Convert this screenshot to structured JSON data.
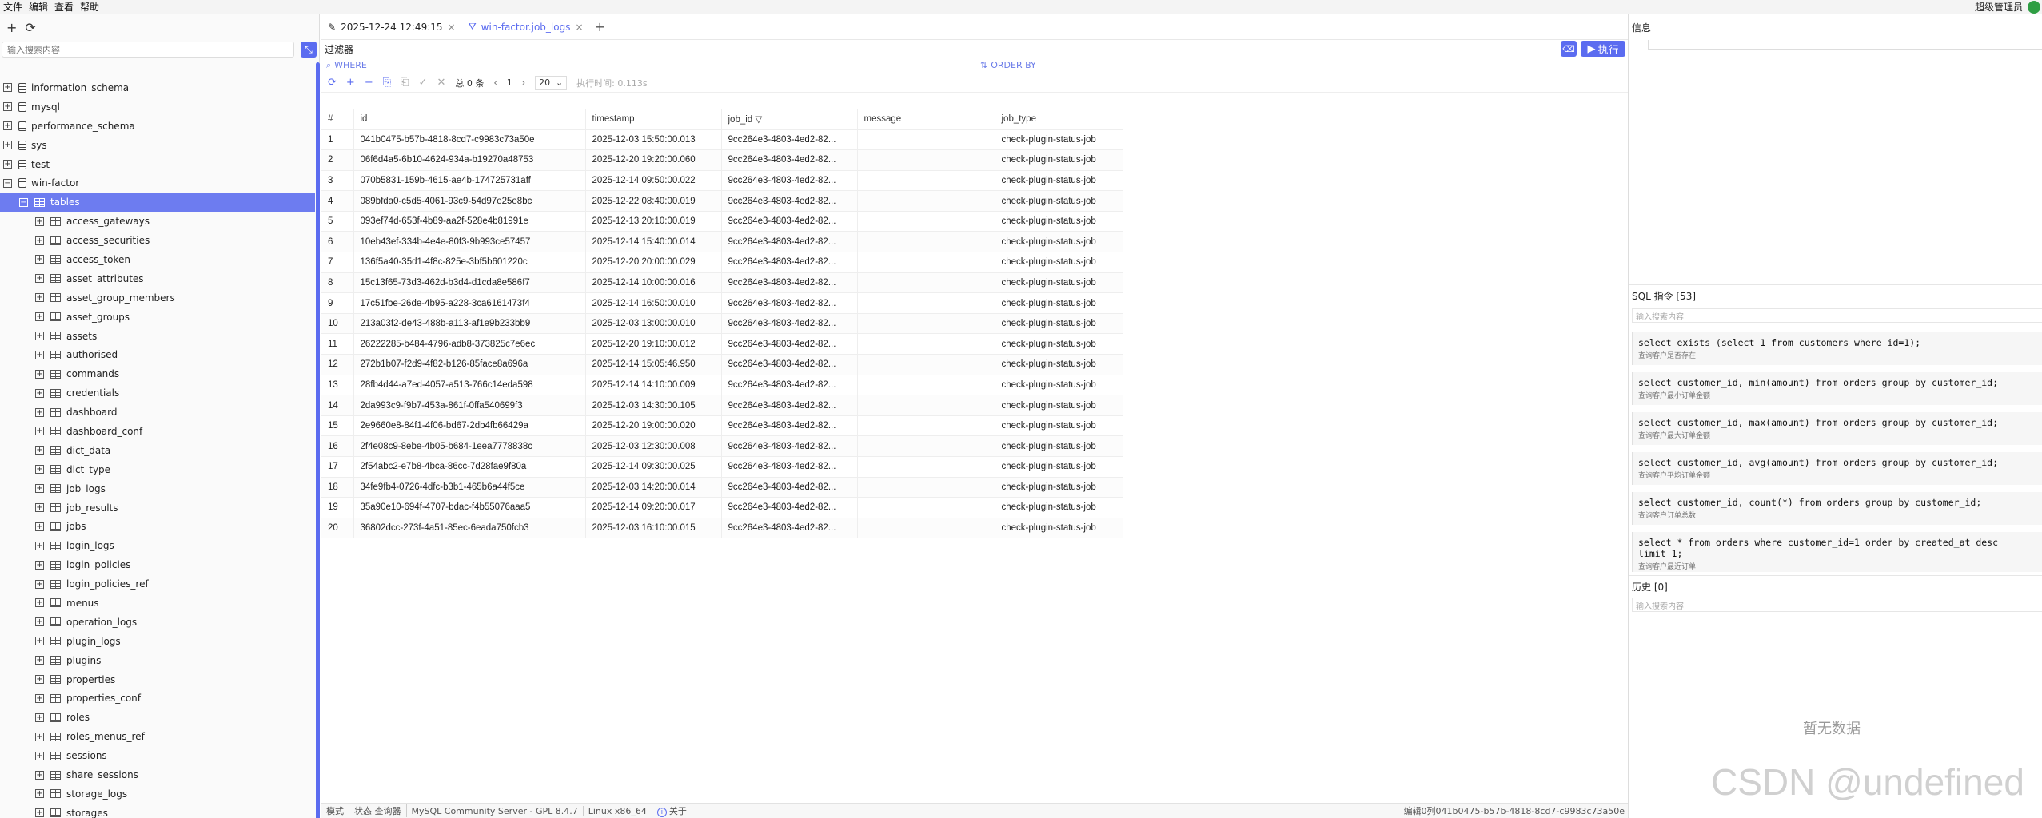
{
  "menubar": {
    "items": [
      "文件",
      "编辑",
      "查看",
      "帮助"
    ],
    "user": "超级管理员"
  },
  "left": {
    "search_placeholder": "输入搜索内容",
    "tree": [
      {
        "label": "information_schema",
        "level": 0,
        "kind": "db",
        "exp": "+"
      },
      {
        "label": "mysql",
        "level": 0,
        "kind": "db",
        "exp": "+"
      },
      {
        "label": "performance_schema",
        "level": 0,
        "kind": "db",
        "exp": "+"
      },
      {
        "label": "sys",
        "level": 0,
        "kind": "db",
        "exp": "+"
      },
      {
        "label": "test",
        "level": 0,
        "kind": "db",
        "exp": "+"
      },
      {
        "label": "win-factor",
        "level": 0,
        "kind": "db",
        "exp": "−"
      },
      {
        "label": "tables",
        "level": 1,
        "kind": "tbl",
        "exp": "−",
        "selected": true
      },
      {
        "label": "access_gateways",
        "level": 2,
        "kind": "tbl",
        "exp": "+"
      },
      {
        "label": "access_securities",
        "level": 2,
        "kind": "tbl",
        "exp": "+"
      },
      {
        "label": "access_token",
        "level": 2,
        "kind": "tbl",
        "exp": "+"
      },
      {
        "label": "asset_attributes",
        "level": 2,
        "kind": "tbl",
        "exp": "+"
      },
      {
        "label": "asset_group_members",
        "level": 2,
        "kind": "tbl",
        "exp": "+"
      },
      {
        "label": "asset_groups",
        "level": 2,
        "kind": "tbl",
        "exp": "+"
      },
      {
        "label": "assets",
        "level": 2,
        "kind": "tbl",
        "exp": "+"
      },
      {
        "label": "authorised",
        "level": 2,
        "kind": "tbl",
        "exp": "+"
      },
      {
        "label": "commands",
        "level": 2,
        "kind": "tbl",
        "exp": "+"
      },
      {
        "label": "credentials",
        "level": 2,
        "kind": "tbl",
        "exp": "+"
      },
      {
        "label": "dashboard",
        "level": 2,
        "kind": "tbl",
        "exp": "+"
      },
      {
        "label": "dashboard_conf",
        "level": 2,
        "kind": "tbl",
        "exp": "+"
      },
      {
        "label": "dict_data",
        "level": 2,
        "kind": "tbl",
        "exp": "+"
      },
      {
        "label": "dict_type",
        "level": 2,
        "kind": "tbl",
        "exp": "+"
      },
      {
        "label": "job_logs",
        "level": 2,
        "kind": "tbl",
        "exp": "+"
      },
      {
        "label": "job_results",
        "level": 2,
        "kind": "tbl",
        "exp": "+"
      },
      {
        "label": "jobs",
        "level": 2,
        "kind": "tbl",
        "exp": "+"
      },
      {
        "label": "login_logs",
        "level": 2,
        "kind": "tbl",
        "exp": "+"
      },
      {
        "label": "login_policies",
        "level": 2,
        "kind": "tbl",
        "exp": "+"
      },
      {
        "label": "login_policies_ref",
        "level": 2,
        "kind": "tbl",
        "exp": "+"
      },
      {
        "label": "menus",
        "level": 2,
        "kind": "tbl",
        "exp": "+"
      },
      {
        "label": "operation_logs",
        "level": 2,
        "kind": "tbl",
        "exp": "+"
      },
      {
        "label": "plugin_logs",
        "level": 2,
        "kind": "tbl",
        "exp": "+"
      },
      {
        "label": "plugins",
        "level": 2,
        "kind": "tbl",
        "exp": "+"
      },
      {
        "label": "properties",
        "level": 2,
        "kind": "tbl",
        "exp": "+"
      },
      {
        "label": "properties_conf",
        "level": 2,
        "kind": "tbl",
        "exp": "+"
      },
      {
        "label": "roles",
        "level": 2,
        "kind": "tbl",
        "exp": "+"
      },
      {
        "label": "roles_menus_ref",
        "level": 2,
        "kind": "tbl",
        "exp": "+"
      },
      {
        "label": "sessions",
        "level": 2,
        "kind": "tbl",
        "exp": "+"
      },
      {
        "label": "share_sessions",
        "level": 2,
        "kind": "tbl",
        "exp": "+"
      },
      {
        "label": "storage_logs",
        "level": 2,
        "kind": "tbl",
        "exp": "+"
      },
      {
        "label": "storages",
        "level": 2,
        "kind": "tbl",
        "exp": "+"
      }
    ]
  },
  "tabs": [
    {
      "label": "2025-12-24 12:49:15",
      "icon": "edit-icon",
      "active": false
    },
    {
      "label": "win-factor.job_logs",
      "icon": "filter-icon",
      "active": true
    }
  ],
  "filter": {
    "label": "过滤器",
    "run_label": "执行",
    "where": "WHERE",
    "orderby": "ORDER BY"
  },
  "grid_toolbar": {
    "total": "总 0 条",
    "page": "1",
    "page_size": "20",
    "exec_time": "执行时间: 0.113s"
  },
  "grid": {
    "columns": [
      "#",
      "id",
      "timestamp",
      "job_id",
      "message",
      "job_type"
    ],
    "rows": [
      [
        "1",
        "041b0475-b57b-4818-8cd7-c9983c73a50e",
        "2025-12-03 15:50:00.013",
        "9cc264e3-4803-4ed2-82...",
        "",
        "check-plugin-status-job"
      ],
      [
        "2",
        "06f6d4a5-6b10-4624-934a-b19270a48753",
        "2025-12-20 19:20:00.060",
        "9cc264e3-4803-4ed2-82...",
        "",
        "check-plugin-status-job"
      ],
      [
        "3",
        "070b5831-159b-4615-ae4b-174725731aff",
        "2025-12-14 09:50:00.022",
        "9cc264e3-4803-4ed2-82...",
        "",
        "check-plugin-status-job"
      ],
      [
        "4",
        "089bfda0-c5d5-4061-93c9-54d97e25e8bc",
        "2025-12-22 08:40:00.019",
        "9cc264e3-4803-4ed2-82...",
        "",
        "check-plugin-status-job"
      ],
      [
        "5",
        "093ef74d-653f-4b89-aa2f-528e4b81991e",
        "2025-12-13 20:10:00.019",
        "9cc264e3-4803-4ed2-82...",
        "",
        "check-plugin-status-job"
      ],
      [
        "6",
        "10eb43ef-334b-4e4e-80f3-9b993ce57457",
        "2025-12-14 15:40:00.014",
        "9cc264e3-4803-4ed2-82...",
        "",
        "check-plugin-status-job"
      ],
      [
        "7",
        "136f5a40-35d1-4f8c-825e-3bf5b601220c",
        "2025-12-20 20:00:00.029",
        "9cc264e3-4803-4ed2-82...",
        "",
        "check-plugin-status-job"
      ],
      [
        "8",
        "15c13f65-73d3-462d-b3d4-d1cda8e586f7",
        "2025-12-14 10:00:00.016",
        "9cc264e3-4803-4ed2-82...",
        "",
        "check-plugin-status-job"
      ],
      [
        "9",
        "17c51fbe-26de-4b95-a228-3ca6161473f4",
        "2025-12-14 16:50:00.010",
        "9cc264e3-4803-4ed2-82...",
        "",
        "check-plugin-status-job"
      ],
      [
        "10",
        "213a03f2-de43-488b-a113-af1e9b233bb9",
        "2025-12-03 13:00:00.010",
        "9cc264e3-4803-4ed2-82...",
        "",
        "check-plugin-status-job"
      ],
      [
        "11",
        "26222285-b484-4796-adb8-373825c7e6ec",
        "2025-12-20 19:10:00.012",
        "9cc264e3-4803-4ed2-82...",
        "",
        "check-plugin-status-job"
      ],
      [
        "12",
        "272b1b07-f2d9-4f82-b126-85face8a696a",
        "2025-12-14 15:05:46.950",
        "9cc264e3-4803-4ed2-82...",
        "",
        "check-plugin-status-job"
      ],
      [
        "13",
        "28fb4d44-a7ed-4057-a513-766c14eda598",
        "2025-12-14 14:10:00.009",
        "9cc264e3-4803-4ed2-82...",
        "",
        "check-plugin-status-job"
      ],
      [
        "14",
        "2da993c9-f9b7-453a-861f-0ffa540699f3",
        "2025-12-03 14:30:00.105",
        "9cc264e3-4803-4ed2-82...",
        "",
        "check-plugin-status-job"
      ],
      [
        "15",
        "2e9660e8-84f1-4f06-bd67-2db4fb66429a",
        "2025-12-20 19:00:00.020",
        "9cc264e3-4803-4ed2-82...",
        "",
        "check-plugin-status-job"
      ],
      [
        "16",
        "2f4e08c9-8ebe-4b05-b684-1eea7778838c",
        "2025-12-03 12:30:00.008",
        "9cc264e3-4803-4ed2-82...",
        "",
        "check-plugin-status-job"
      ],
      [
        "17",
        "2f54abc2-e7b8-4bca-86cc-7d28fae9f80a",
        "2025-12-14 09:30:00.025",
        "9cc264e3-4803-4ed2-82...",
        "",
        "check-plugin-status-job"
      ],
      [
        "18",
        "34fe9fb4-0726-4dfc-b3b1-465b6a44f5ce",
        "2025-12-03 14:20:00.014",
        "9cc264e3-4803-4ed2-82...",
        "",
        "check-plugin-status-job"
      ],
      [
        "19",
        "35a90e10-694f-4707-bdac-f4b55076aaa5",
        "2025-12-14 09:20:00.017",
        "9cc264e3-4803-4ed2-82...",
        "",
        "check-plugin-status-job"
      ],
      [
        "20",
        "36802dcc-273f-4a51-85ec-6eada750fcb3",
        "2025-12-03 16:10:00.015",
        "9cc264e3-4803-4ed2-82...",
        "",
        "check-plugin-status-job"
      ]
    ]
  },
  "status_bar": {
    "mode": "模式",
    "state": "状态 查询器",
    "server": "MySQL Community Server - GPL 8.4.7",
    "os": "Linux x86_64",
    "about": "关于",
    "right_text": "编辑0列041b0475-b57b-4818-8cd7-c9983c73a50e"
  },
  "right": {
    "info_title": "信息",
    "sql_title": "SQL 指令 [53]",
    "sql_search_placeholder": "输入搜索内容",
    "sql_items": [
      {
        "code": "select exists (select 1 from customers where id=1);",
        "desc": "查询客户是否存在"
      },
      {
        "code": "select customer_id, min(amount) from orders group by customer_id;",
        "desc": "查询客户最小订单金额"
      },
      {
        "code": "select customer_id, max(amount) from orders group by customer_id;",
        "desc": "查询客户最大订单金额"
      },
      {
        "code": "select customer_id, avg(amount) from orders group by customer_id;",
        "desc": "查询客户平均订单金额"
      },
      {
        "code": "select customer_id, count(*) from orders group by customer_id;",
        "desc": "查询客户订单总数"
      },
      {
        "code": "select * from orders where customer_id=1 order by created_at desc\nlimit 1;",
        "desc": "查询客户最近订单"
      }
    ],
    "history_title": "历史 [0]",
    "history_search_placeholder": "输入搜索内容",
    "empty_text": "暂无数据"
  },
  "watermark": "CSDN @undefined",
  "colors": {
    "accent": "#5b6cf0",
    "selected_row": "#6d7cf0"
  }
}
